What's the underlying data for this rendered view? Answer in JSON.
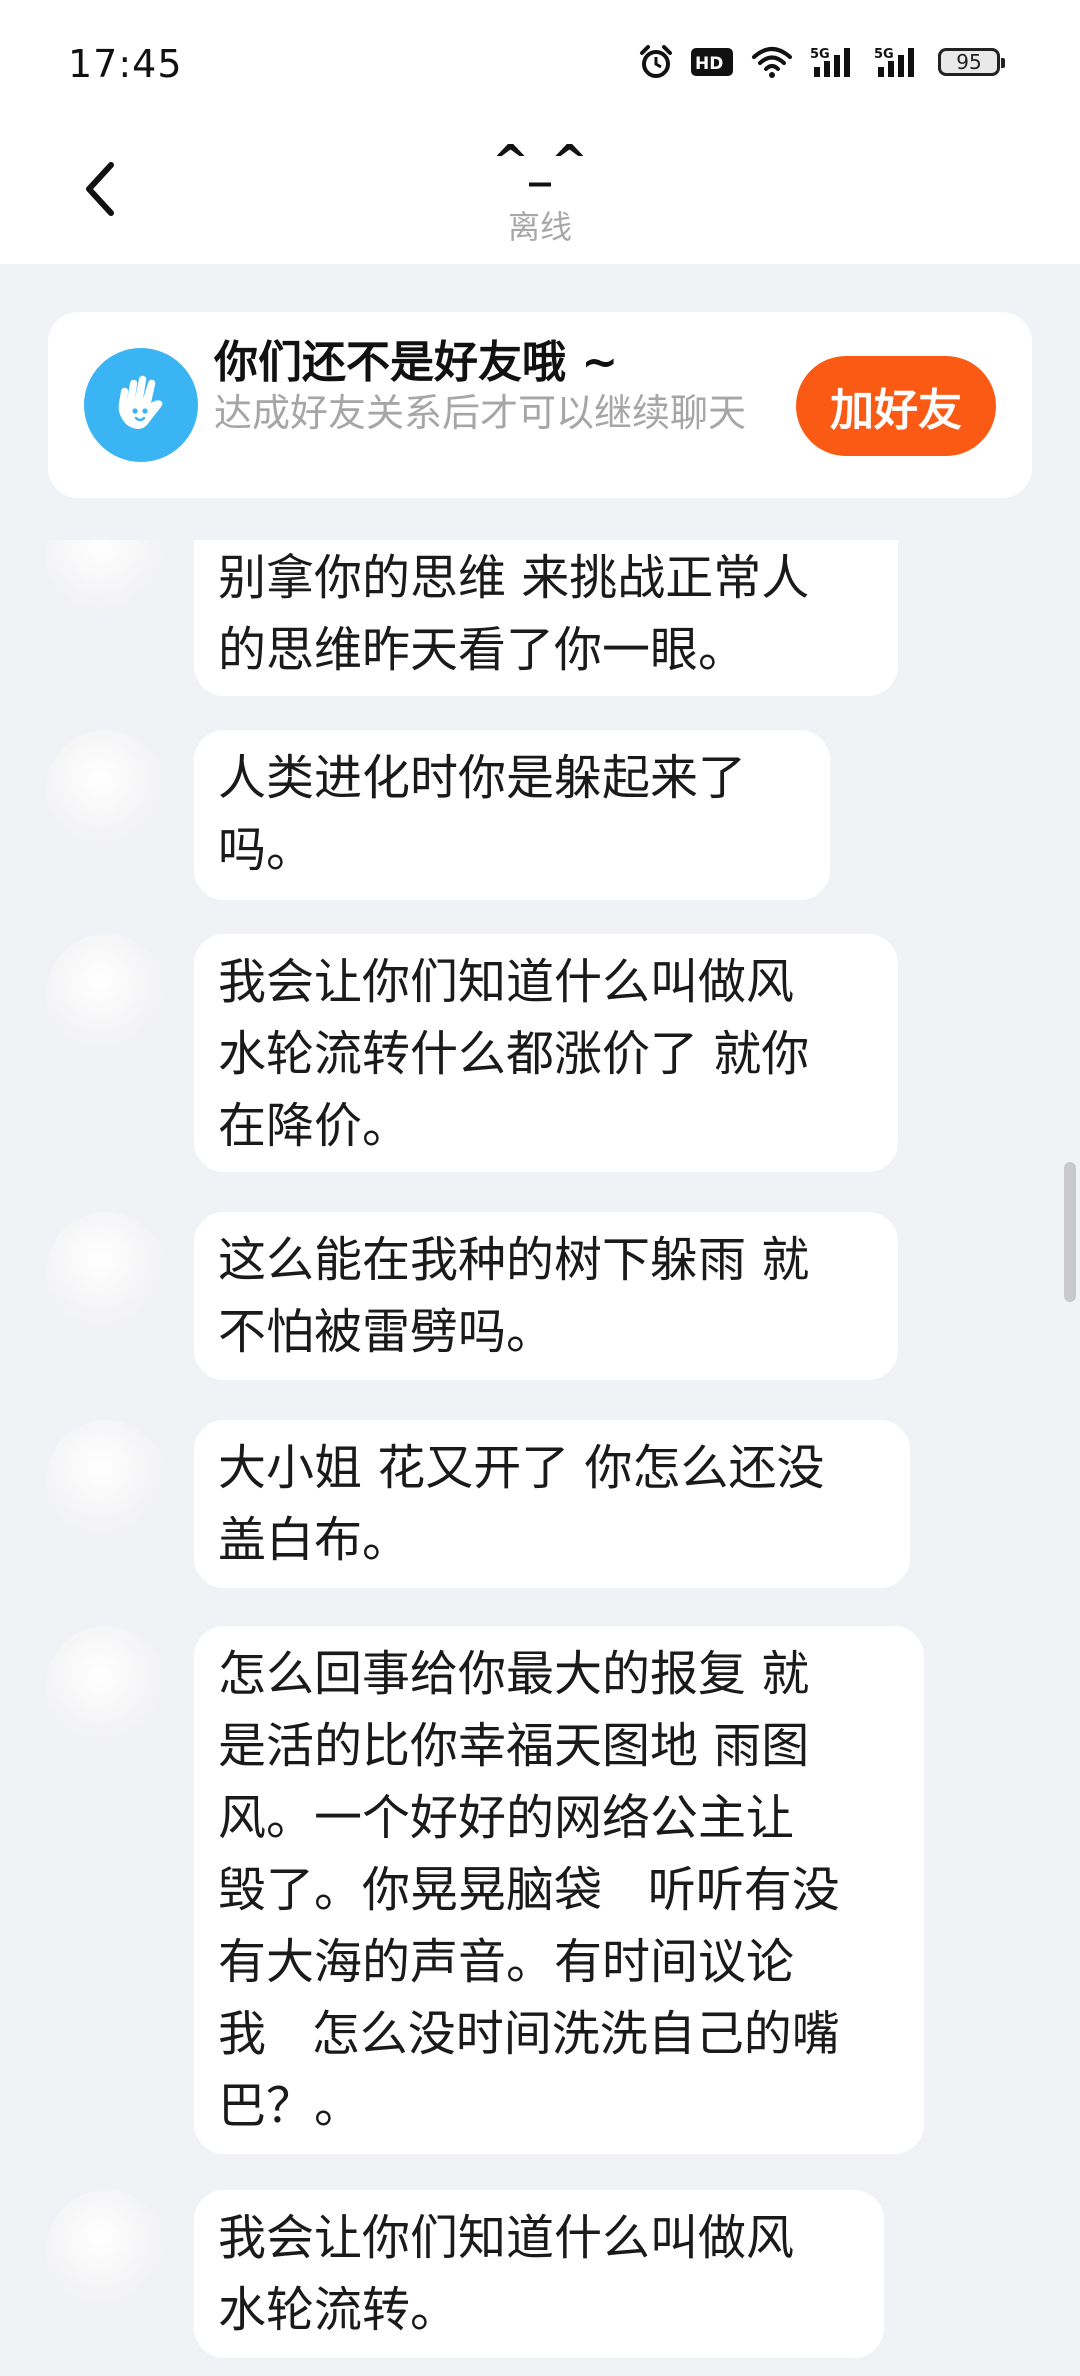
{
  "status_bar": {
    "time": "17:45",
    "battery": "95",
    "icons": [
      "alarm-icon",
      "hd-icon",
      "wifi-icon",
      "5g-signal-icon",
      "5g-signal-icon"
    ]
  },
  "header": {
    "title": "^_^",
    "subtitle": "离线",
    "back_icon": "chevron-left-icon"
  },
  "notice": {
    "title": "你们还不是好友哦 ~",
    "description": "达成好友关系后才可以继续聊天",
    "button_label": "加好友",
    "icon": "wave-hand-icon",
    "accent_color": "#fa5a14",
    "avatar_color": "#3ab4f2"
  },
  "messages": [
    {
      "text": "别拿你的思维 来挑战正常人\n的思维昨天看了你一眼。"
    },
    {
      "text": "人类进化时你是躲起来了\n吗。"
    },
    {
      "text": "我会让你们知道什么叫做风\n水轮流转什么都涨价了 就你\n在降价。"
    },
    {
      "text": "这么能在我种的树下躲雨 就\n不怕被雷劈吗。"
    },
    {
      "text": "大小姐 花又开了 你怎么还没\n盖白布。"
    },
    {
      "text": "怎么回事给你最大的报复 就\n是活的比你幸福天图地 雨图\n风。一个好好的网络公主让\n毁了。你晃晃脑袋   听听有没\n有大海的声音。有时间议论\n我   怎么没时间洗洗自己的嘴\n巴？。"
    },
    {
      "text": "我会让你们知道什么叫做风\n水轮流转。"
    }
  ]
}
